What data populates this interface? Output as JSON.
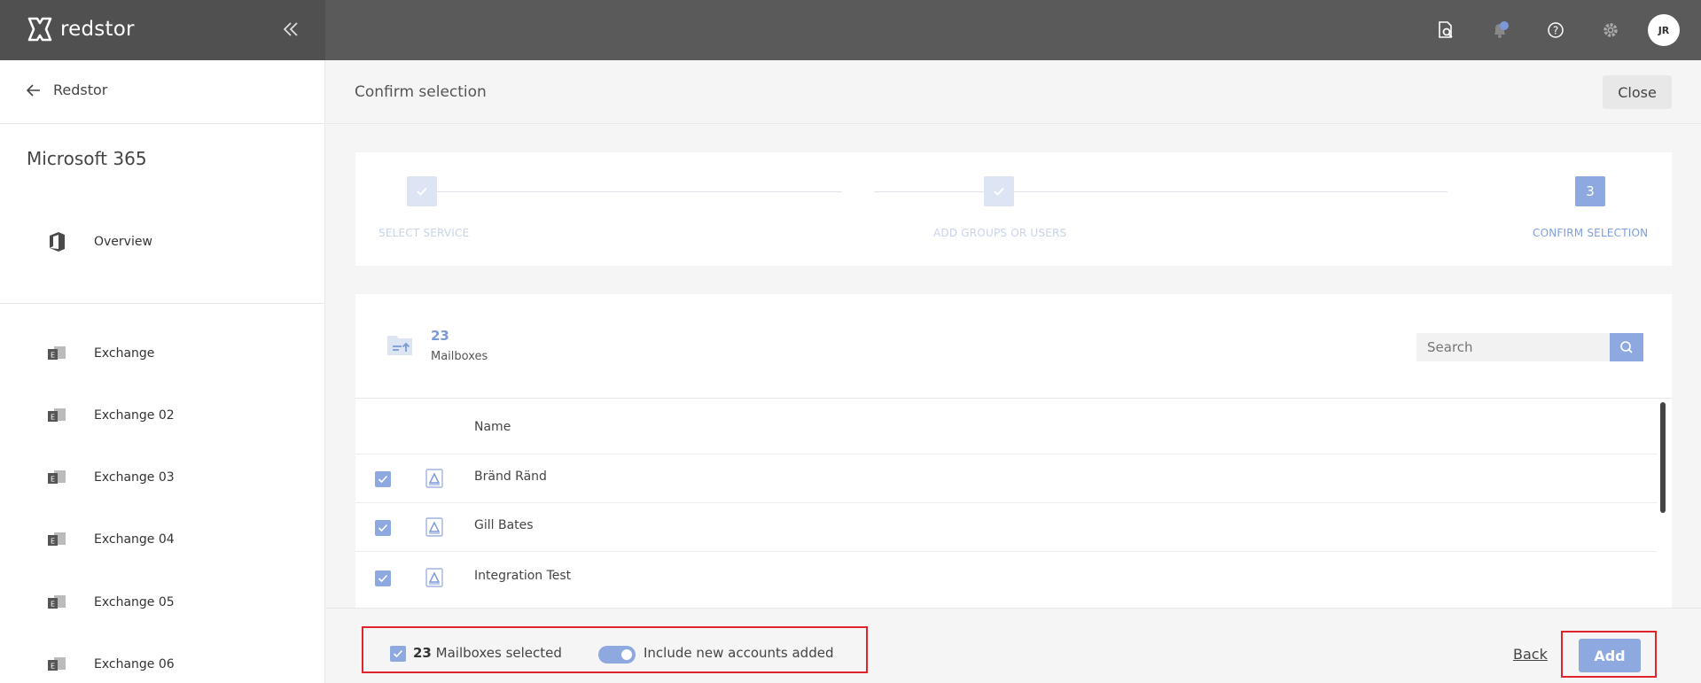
{
  "brand": {
    "name": "redstor"
  },
  "topbar": {
    "icons": [
      "search-doc-icon",
      "bell-icon",
      "help-icon",
      "gear-icon"
    ],
    "avatar_initials": "JR"
  },
  "sidebar": {
    "back_label": "Redstor",
    "title": "Microsoft 365",
    "overview_label": "Overview",
    "items": [
      {
        "label": "Exchange"
      },
      {
        "label": "Exchange 02"
      },
      {
        "label": "Exchange 03"
      },
      {
        "label": "Exchange 04"
      },
      {
        "label": "Exchange 05"
      },
      {
        "label": "Exchange 06"
      }
    ]
  },
  "header": {
    "title": "Confirm selection",
    "close_label": "Close"
  },
  "stepper": {
    "steps": [
      {
        "label": "SELECT SERVICE",
        "state": "done"
      },
      {
        "label": "ADD GROUPS OR USERS",
        "state": "done"
      },
      {
        "label": "CONFIRM SELECTION",
        "state": "active",
        "number": "3"
      }
    ]
  },
  "panel": {
    "count": "23",
    "count_label": "Mailboxes",
    "search_placeholder": "Search",
    "column_name": "Name",
    "rows": [
      {
        "name": "Bränd Ränd",
        "checked": true
      },
      {
        "name": "Gill Bates",
        "checked": true
      },
      {
        "name": "Integration Test",
        "checked": true
      }
    ]
  },
  "footer": {
    "selected_count": "23",
    "selected_label": "Mailboxes selected",
    "toggle_label": "Include new accounts added",
    "toggle_on": true,
    "back_label": "Back",
    "add_label": "Add"
  },
  "colors": {
    "accent": "#8ea8e0",
    "topbar": "#5a5a5a",
    "highlight": "#e0242c"
  }
}
